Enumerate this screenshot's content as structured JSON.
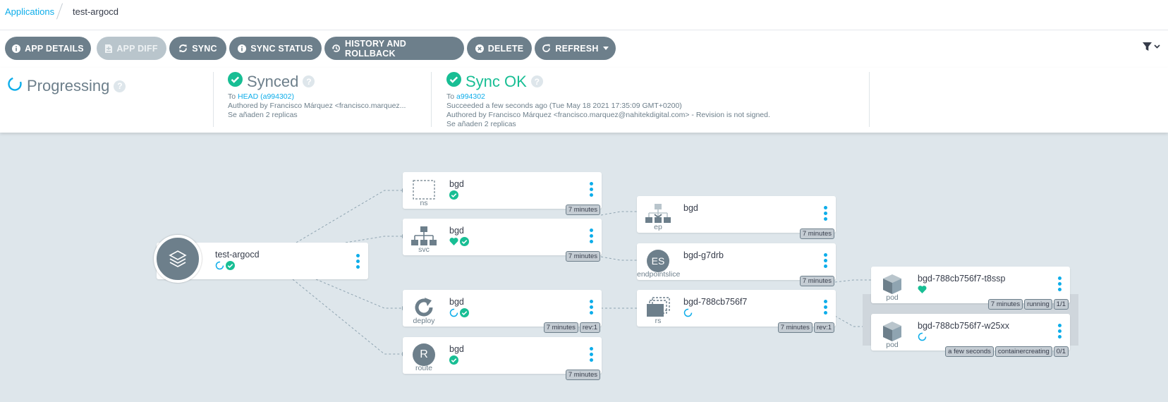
{
  "breadcrumb": {
    "root": "Applications",
    "current": "test-argocd"
  },
  "toolbar": {
    "app_details": "APP DETAILS",
    "app_diff": "APP DIFF",
    "sync": "SYNC",
    "sync_status": "SYNC STATUS",
    "history": "HISTORY AND ROLLBACK",
    "delete": "DELETE",
    "refresh": "REFRESH"
  },
  "status": {
    "health": {
      "label": "Progressing"
    },
    "sync": {
      "label": "Synced",
      "to_prefix": "To",
      "to_value": "HEAD (a994302)",
      "author": "Authored by Francisco Márquez <francisco.marquez...",
      "message": "Se añaden 2 replicas"
    },
    "operation": {
      "label": "Sync OK",
      "to_prefix": "To",
      "to_value": "a994302",
      "succeeded": "Succeeded a few seconds ago (Tue May 18 2021 17:35:09 GMT+0200)",
      "author": "Authored by Francisco Márquez <francisco.marquez@nahitekdigital.com> - Revision is not signed.",
      "message": "Se añaden 2 replicas"
    }
  },
  "colors": {
    "accent": "#0dadea",
    "healthy": "#18be94",
    "progressing": "#0dadea",
    "neutral": "#6d7f8b"
  },
  "app": {
    "name": "test-argocd"
  },
  "nodes": {
    "ns": {
      "name": "bgd",
      "kind": "ns",
      "tags": [
        "7 minutes"
      ]
    },
    "svc": {
      "name": "bgd",
      "kind": "svc",
      "tags": [
        "7 minutes"
      ]
    },
    "deploy": {
      "name": "bgd",
      "kind": "deploy",
      "tags": [
        "7 minutes",
        "rev:1"
      ]
    },
    "route": {
      "name": "bgd",
      "kind": "route",
      "icon_text": "R",
      "tags": [
        "7 minutes"
      ]
    },
    "ep": {
      "name": "bgd",
      "kind": "ep",
      "tags": [
        "7 minutes"
      ]
    },
    "es": {
      "name": "bgd-g7drb",
      "kind": "endpointslice",
      "icon_text": "ES",
      "tags": [
        "7 minutes"
      ]
    },
    "rs": {
      "name": "bgd-788cb756f7",
      "kind": "rs",
      "tags": [
        "7 minutes",
        "rev:1"
      ]
    },
    "pod1": {
      "name": "bgd-788cb756f7-t8ssp",
      "kind": "pod",
      "tags": [
        "7 minutes",
        "running",
        "1/1"
      ]
    },
    "pod2": {
      "name": "bgd-788cb756f7-w25xx",
      "kind": "pod",
      "tags": [
        "a few seconds",
        "containercreating",
        "0/1"
      ]
    }
  }
}
